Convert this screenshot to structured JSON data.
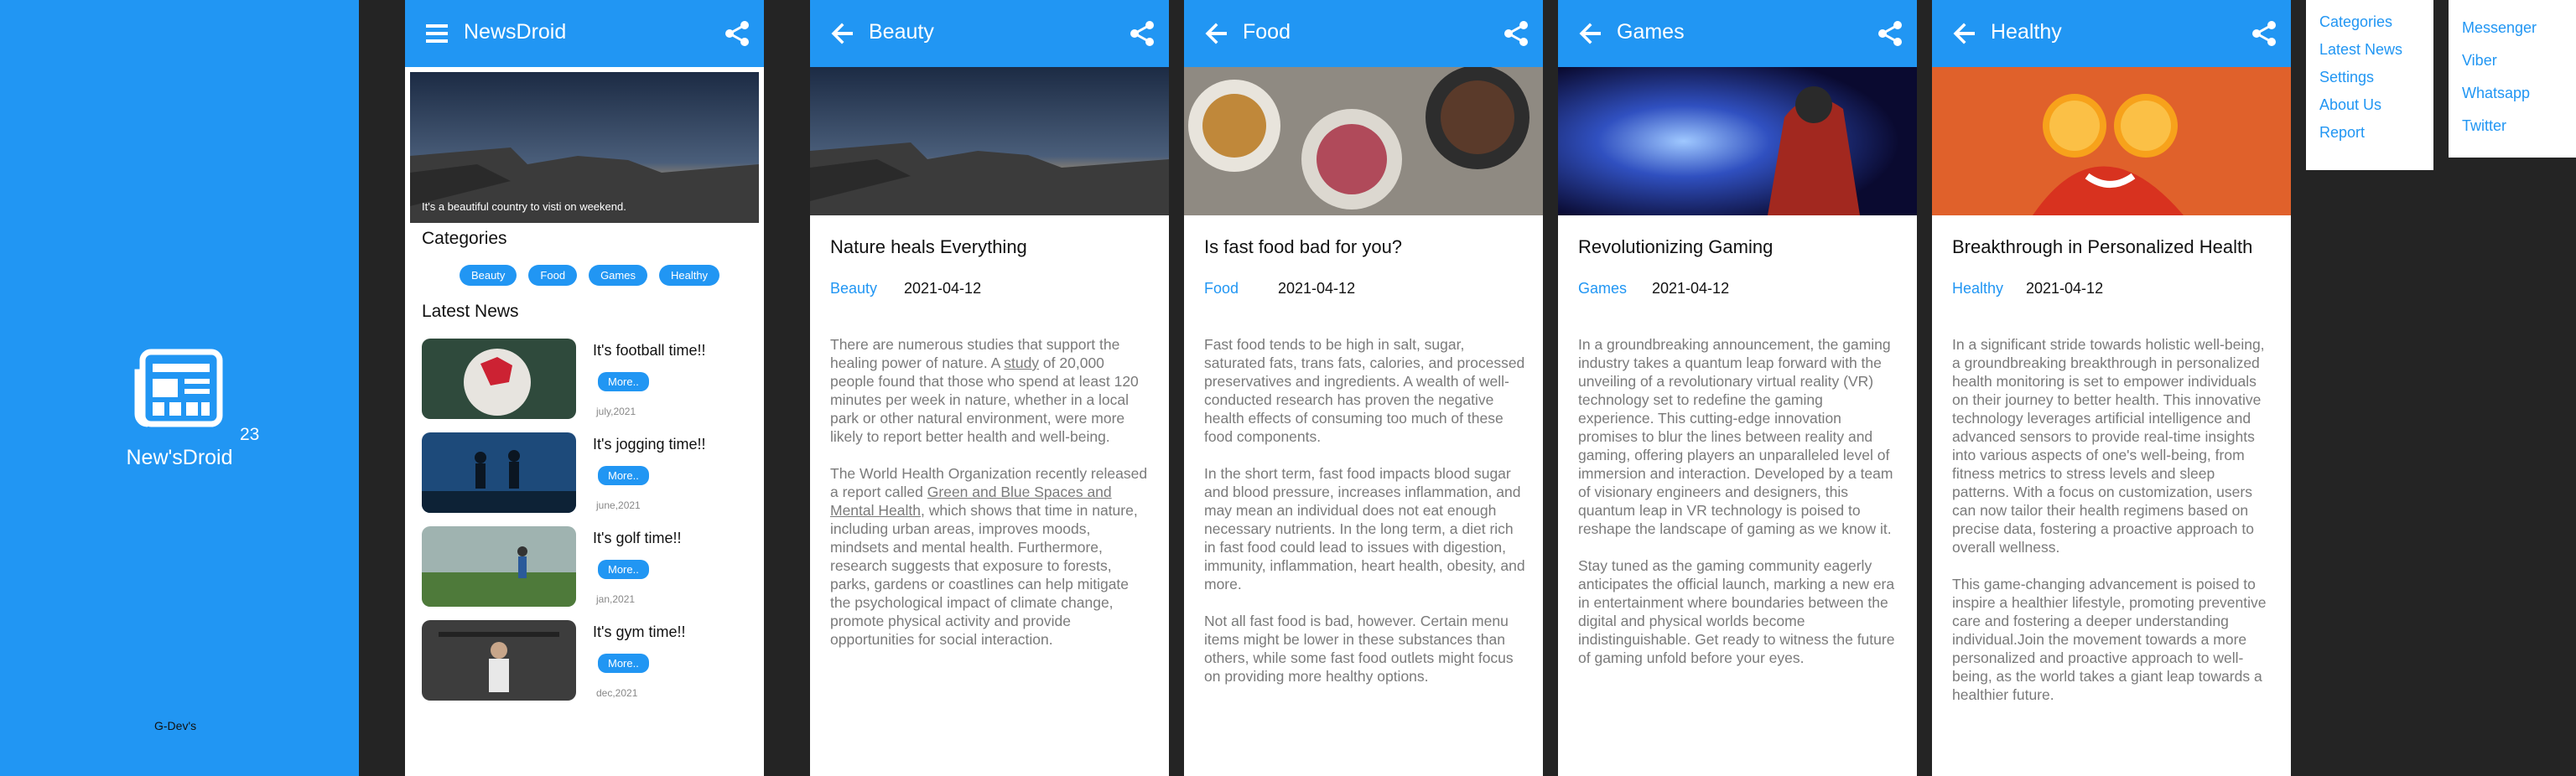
{
  "splash": {
    "title": "New'sDroid",
    "version": "23",
    "credit": "G-Dev's"
  },
  "home": {
    "app_title": "NewsDroid",
    "hero_caption": "It's a beautiful country to visti on weekend.",
    "categories_heading": "Categories",
    "chips": [
      "Beauty",
      "Food",
      "Games",
      "Healthy"
    ],
    "latest_heading": "Latest News",
    "news": [
      {
        "title": "It's football time!!",
        "more": "More..",
        "date": "july,2021"
      },
      {
        "title": "It's jogging time!!",
        "more": "More..",
        "date": "june,2021"
      },
      {
        "title": "It's golf time!!",
        "more": "More..",
        "date": "jan,2021"
      },
      {
        "title": "It's gym time!!",
        "more": "More..",
        "date": "dec,2021"
      }
    ]
  },
  "articles": [
    {
      "bar_title": "Beauty",
      "headline": "Nature heals Everything",
      "category": "Beauty",
      "date": "2021-04-12",
      "p1_a": "There are numerous studies that support the healing power of nature. A ",
      "p1_link": "study",
      "p1_b": " of 20,000 people found that those who spend at least 120 minutes per week in nature, whether in a local park or other natural environment, were more likely to report better health and well-being.",
      "p2_a": "The World Health Organization recently released a report called ",
      "p2_link": "Green and Blue Spaces and Mental Health",
      "p2_b": ", which shows that time in nature, including urban areas, improves moods, mindsets and mental health. Furthermore, research suggests that exposure to forests, parks, gardens or coastlines can help mitigate the psychological impact of climate change, promote physical activity and provide opportunities for social interaction."
    },
    {
      "bar_title": "Food",
      "headline": "Is fast food bad for you?",
      "category": "Food",
      "date": "2021-04-12",
      "p1": "Fast food tends to be high in salt, sugar, saturated fats, trans fats, calories, and processed preservatives and ingredients. A wealth of well-conducted research has proven the negative health effects of consuming too much of these food components.",
      "p2": "In the short term, fast food impacts blood sugar and blood pressure, increases inflammation, and may mean an individual does not eat enough necessary nutrients. In the long term, a diet rich in fast food could lead to issues with digestion, immunity, inflammation, heart health, obesity, and more.",
      "p3": "Not all fast food is bad, however. Certain menu items might be lower in these substances than others, while some fast food outlets might focus on providing more healthy options."
    },
    {
      "bar_title": "Games",
      "headline": "Revolutionizing Gaming",
      "category": "Games",
      "date": "2021-04-12",
      "p1": "In a groundbreaking announcement, the gaming industry takes a quantum leap forward with the unveiling of a revolutionary virtual reality (VR) technology set to redefine the gaming experience. This cutting-edge innovation promises to blur the lines between reality and gaming, offering players an unparalleled level of immersion and interaction. Developed by a team of visionary engineers and designers, this quantum leap in VR technology is poised to reshape the landscape of gaming as we know it.",
      "p2": "Stay tuned as the gaming community eagerly anticipates the official launch, marking a new era in entertainment where boundaries between the digital and physical worlds become indistinguishable. Get ready to witness the future of gaming unfold before your eyes."
    },
    {
      "bar_title": "Healthy",
      "headline": "Breakthrough in Personalized Health",
      "category": "Healthy",
      "date": "2021-04-12",
      "p1": "In a significant stride towards holistic well-being, a groundbreaking breakthrough in personalized health monitoring is set to empower individuals on their journey to better health. This innovative technology leverages artificial intelligence and advanced sensors to provide real-time insights into various aspects of one's well-being, from fitness metrics to stress levels and sleep patterns. With a focus on customization, users can now tailor their health regimens based on precise data, fostering a proactive approach to overall wellness.",
      "p2": "This game-changing advancement is poised to inspire a healthier lifestyle, promoting preventive care and fostering a deeper understanding individual.Join the movement towards a more personalized and proactive approach to well-being, as the world takes a giant leap towards a healthier future."
    }
  ],
  "menu_main": [
    "Categories",
    "Latest News",
    "Settings",
    "About Us",
    "Report"
  ],
  "menu_share": [
    "Messenger",
    "Viber",
    "Whatsapp",
    "Twitter"
  ],
  "colors": {
    "primary": "#2196f3",
    "background": "#242424"
  }
}
